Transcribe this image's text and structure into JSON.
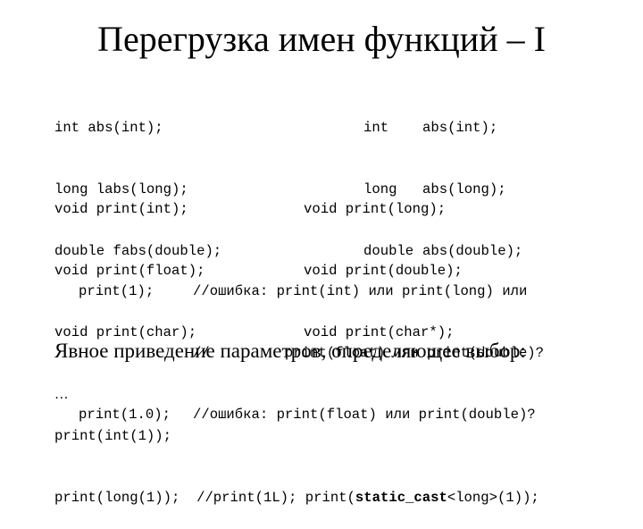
{
  "slide": {
    "title": "Перегрузка имен функций – I",
    "c_functions": [
      "int abs(int);",
      "long labs(long);",
      "double fabs(double);"
    ],
    "cpp_functions": [
      {
        "type": "int",
        "decl": "abs(int);"
      },
      {
        "type": "long",
        "decl": "abs(long);"
      },
      {
        "type": "double",
        "decl": "abs(double);"
      }
    ],
    "print_left": [
      "void print(int);",
      "void print(float);",
      "void print(char);"
    ],
    "print_right": [
      "void print(long);",
      "void print(double);",
      "void print(char*);"
    ],
    "ellipsis": "…",
    "calls": [
      {
        "call": "print(1);",
        "comment": "//ошибка: print(int) или print(long) или"
      },
      {
        "call": "",
        "comment": "//         print(float) или print(double)?"
      },
      {
        "call": "print(1.0);",
        "comment": "//ошибка: print(float) или print(double)?"
      }
    ],
    "heading": "Явное приведение параметров, определяющее выбор:",
    "explicit": {
      "line1": "print(int(1));",
      "line2": "print(long(1));",
      "comment_prefix": "//print(1L); print(",
      "keyword": "static_cast",
      "comment_suffix": "<long>(1));"
    }
  }
}
